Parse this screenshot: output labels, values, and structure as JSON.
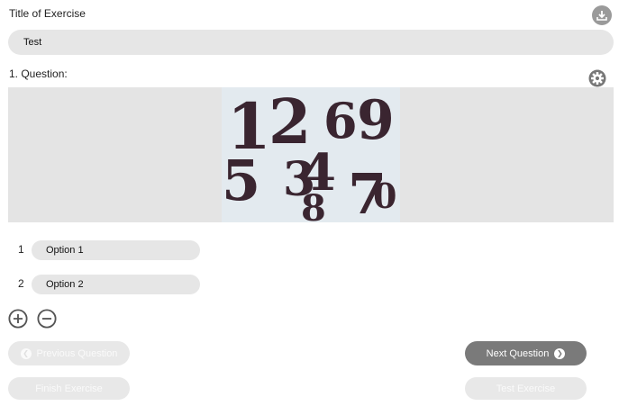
{
  "title_label": "Title of Exercise",
  "title_value": "Test",
  "question_label": "1. Question:",
  "question_image_text": "1 2 6 9 5 3 4 8 7 0",
  "options": [
    {
      "number": "1",
      "label": "Option 1"
    },
    {
      "number": "2",
      "label": "Option 2"
    }
  ],
  "buttons": {
    "previous": "Previous Question",
    "next": "Next Question",
    "finish": "Finish Exercise",
    "test": "Test Exercise"
  },
  "icons": {
    "download": "download-icon",
    "settings": "gear-icon",
    "add": "plus-circle-icon",
    "remove": "minus-circle-icon"
  }
}
